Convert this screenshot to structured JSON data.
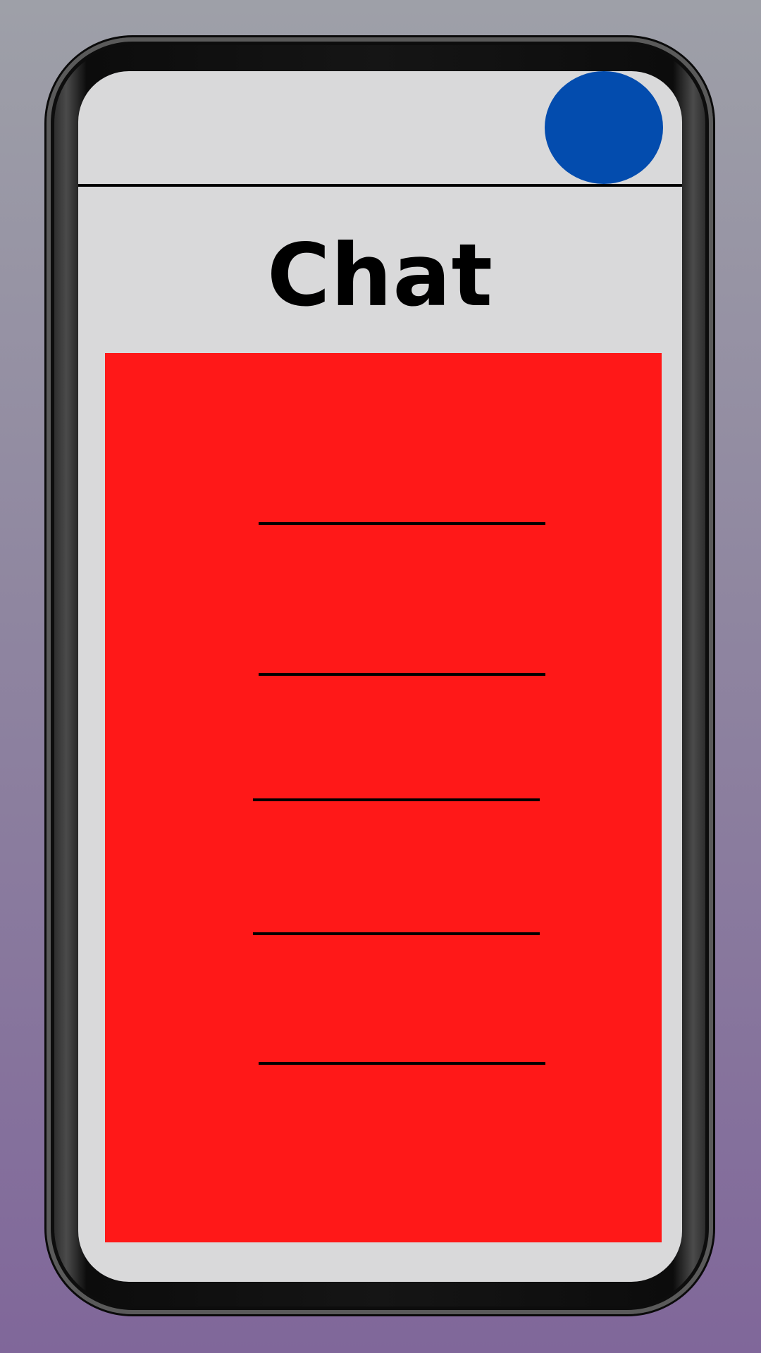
{
  "header": {
    "title": "Chat",
    "avatar_color": "#034cae"
  },
  "chat_list": {
    "background_color": "#ff1818",
    "item_count": 5
  },
  "colors": {
    "screen_background": "#d9d9da",
    "phone_frame": "#151515"
  }
}
